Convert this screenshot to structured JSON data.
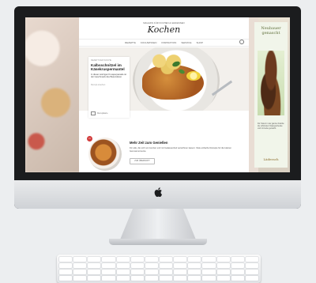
{
  "site": {
    "logo_small": "MAGAZIN FÜR KOCHEN & GENIESSEN",
    "logo": "Kochen",
    "nav": [
      "REZEPTE",
      "KOCHWISSEN",
      "INSPIRATION",
      "SERVICE",
      "SHOP"
    ]
  },
  "hero": {
    "kicker": "REZEPT DER WOCHE",
    "title": "Kalbsschnitzel im Käsekruspermantel",
    "text": "In dieser würzigen Knusperpanade ist der Geschmack des Besonderen",
    "link": "Rezept ansehen",
    "footer": "Rezeptkarte"
  },
  "teaser": {
    "badge": "N",
    "title": "Mehr Zeit zum Genießen",
    "text": "Für alle, die sich von Herzen und mit Gelassenheit verwöhnen lassen: Viele einfache Rezepte für die kleinen Genussmomente.",
    "button": "ZUR ÜBERSICHT"
  },
  "ad": {
    "headline": "Neubauer genascht",
    "text": "Für Ostern in der ganzen Familie die schönsten Ostergeschenke und mit Liebe gemacht.",
    "brand": "Läderach"
  }
}
